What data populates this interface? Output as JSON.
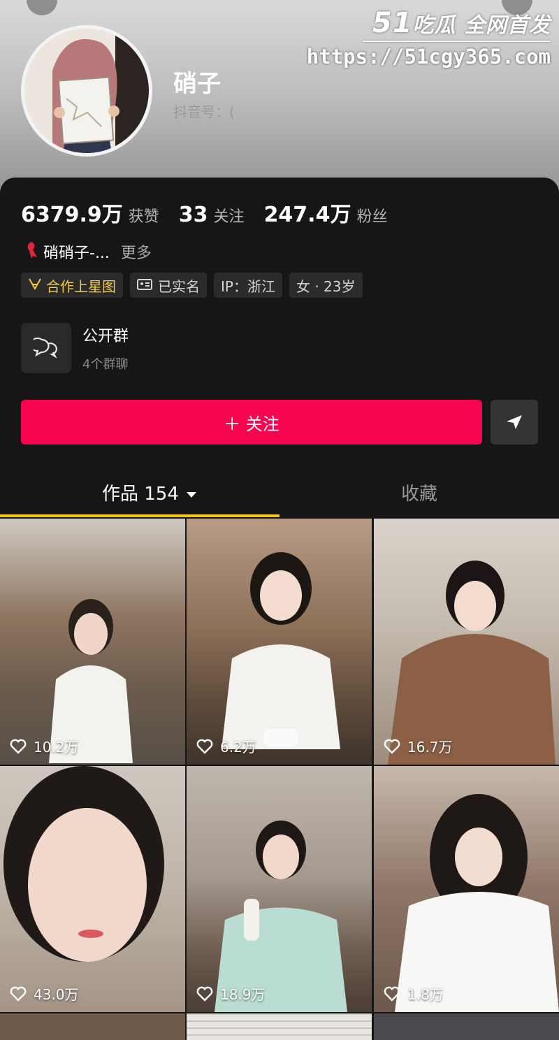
{
  "profile": {
    "nickname": "硝子",
    "douyin_id_label": "抖音号：(",
    "stats": [
      {
        "value": "6379.9万",
        "label": "获赞"
      },
      {
        "value": "33",
        "label": "关注"
      },
      {
        "value": "247.4万",
        "label": "粉丝"
      }
    ],
    "bio": "硝硝子-...",
    "bio_more": "更多",
    "tags": [
      {
        "icon": "star-chart-icon",
        "label": "合作上星图"
      },
      {
        "icon": "id-card-icon",
        "label": "已实名"
      },
      {
        "label": "IP：浙江"
      },
      {
        "label": "女 · 23岁"
      }
    ]
  },
  "group": {
    "title": "公开群",
    "subtitle": "4个群聊"
  },
  "actions": {
    "follow_label": "＋ 关注"
  },
  "tabs": {
    "works_label": "作品 154",
    "favorites_label": "收藏"
  },
  "watermark": {
    "brand_num": "51",
    "brand_text": "吃瓜 全网首发",
    "url": "https://51cgy365.com"
  },
  "videos": [
    {
      "likes": "10.2万"
    },
    {
      "likes": "6.2万"
    },
    {
      "likes": "16.7万"
    },
    {
      "likes": "43.0万"
    },
    {
      "likes": "18.9万"
    },
    {
      "likes": "1.8万"
    }
  ],
  "colors": {
    "accent": "#f7054f",
    "tab_indicator": "#f5c518",
    "panel_bg": "#161616"
  }
}
